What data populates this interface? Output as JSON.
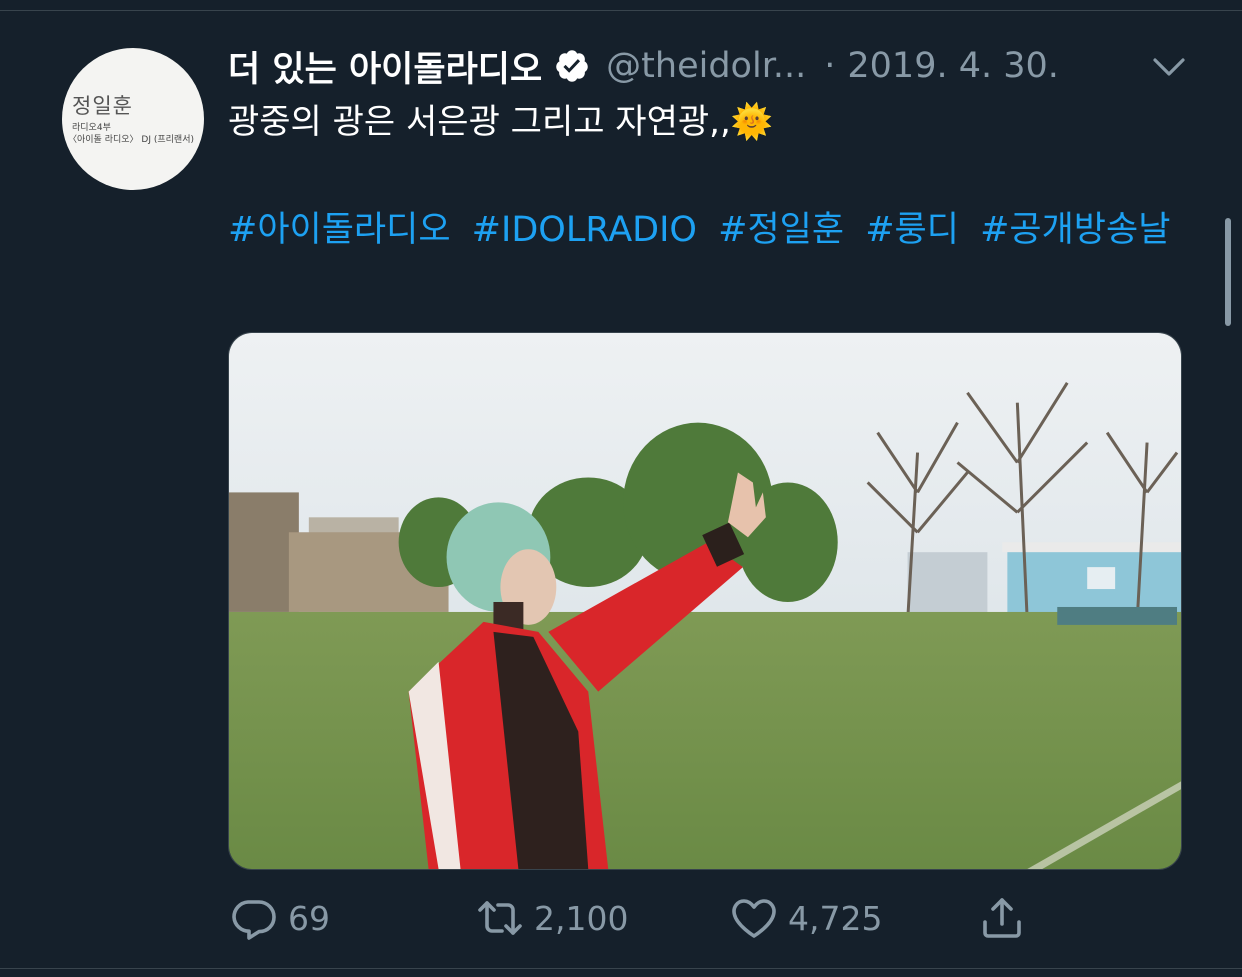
{
  "tweet": {
    "avatar": {
      "name_text": "정일훈",
      "line1": "라디오4부",
      "line2": "〈아이돌 라디오〉 DJ (프리랜서)"
    },
    "display_name": "더 있는 아이돌라디오",
    "handle": "@theidolr...",
    "separator": "·",
    "date": "2019. 4. 30.",
    "text": "광중의 광은 서은광 그리고 자연광,,🌞",
    "hashtags": [
      "#아이돌라디오",
      "#IDOLRADIO",
      "#정일훈",
      "#룽디",
      "#공개방송날"
    ],
    "media_alt": "photo",
    "actions": {
      "reply": {
        "icon": "reply-icon",
        "count": "69"
      },
      "retweet": {
        "icon": "retweet-icon",
        "count": "2,100"
      },
      "like": {
        "icon": "heart-icon",
        "count": "4,725"
      },
      "share": {
        "icon": "share-icon"
      }
    }
  },
  "colors": {
    "background": "#15202b",
    "text": "#ffffff",
    "secondary": "#8899a6",
    "link": "#1da1f2",
    "verified": "#ffffff"
  }
}
